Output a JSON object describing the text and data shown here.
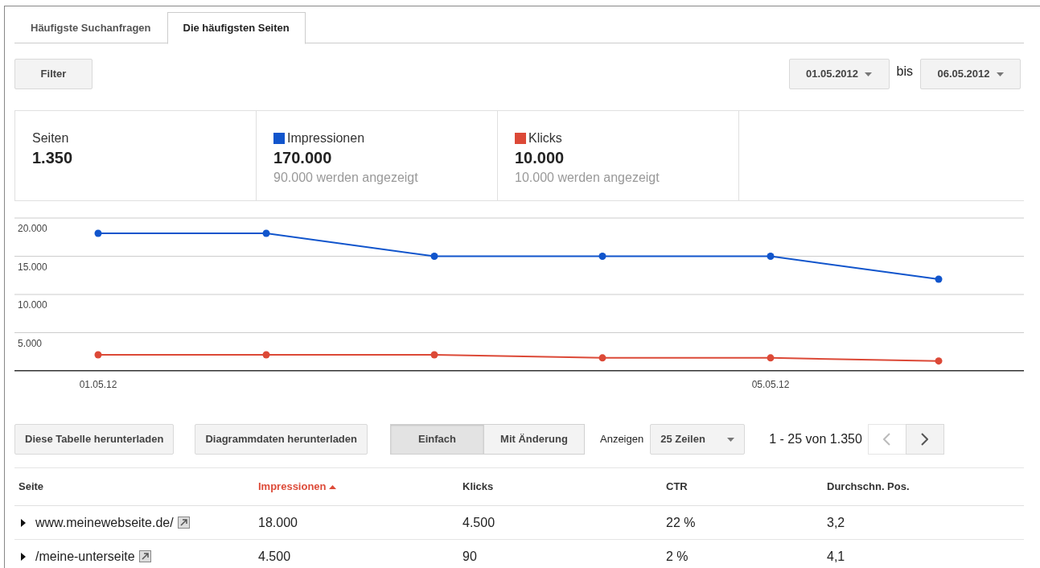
{
  "tabs": [
    {
      "label": "Häufigste Suchanfragen",
      "selected": false
    },
    {
      "label": "Die häufigsten Seiten",
      "selected": true
    }
  ],
  "filter_button": "Filter",
  "date_range": {
    "from": "01.05.2012",
    "separator": "bis",
    "to": "06.05.2012"
  },
  "summary": [
    {
      "label": "Seiten",
      "value": "1.350"
    },
    {
      "label": "Impressionen",
      "value": "170.000",
      "note": "90.000 werden angezeigt",
      "color": "#1155cc"
    },
    {
      "label": "Klicks",
      "value": "10.000",
      "note": "10.000 werden angezeigt",
      "color": "#dc4937"
    }
  ],
  "chart_data": {
    "type": "line",
    "grid": true,
    "categories": [
      "01.05.12",
      null,
      null,
      null,
      "05.05.12",
      null
    ],
    "ylim": [
      0,
      20000
    ],
    "yticks": [
      {
        "value": 5000,
        "label": "5.000"
      },
      {
        "value": 10000,
        "label": "10.000"
      },
      {
        "value": 15000,
        "label": "15.000"
      },
      {
        "value": 20000,
        "label": "20.000"
      }
    ],
    "series": [
      {
        "color": "#1155cc",
        "marker": "circle",
        "values": [
          18000,
          18000,
          15000,
          15000,
          15000,
          12000
        ]
      },
      {
        "color": "#dc4937",
        "marker": "circle",
        "values": [
          2100,
          2100,
          2100,
          1700,
          1700,
          1300
        ]
      }
    ]
  },
  "toolbar": {
    "download_table": "Diese Tabelle herunterladen",
    "download_chart": "Diagrammdaten herunterladen",
    "view_modes": [
      {
        "label": "Einfach",
        "selected": true
      },
      {
        "label": "Mit Änderung",
        "selected": false
      }
    ],
    "show_label": "Anzeigen",
    "rows_select": "25 Zeilen",
    "range": "1 - 25 von 1.350"
  },
  "table": {
    "columns": [
      {
        "label": "Seite",
        "sorted": false
      },
      {
        "label": "Impressionen",
        "sorted": true
      },
      {
        "label": "Klicks",
        "sorted": false
      },
      {
        "label": "CTR",
        "sorted": false
      },
      {
        "label": "Durchschn. Pos.",
        "sorted": false
      }
    ],
    "rows": [
      {
        "expanded": false,
        "cells": [
          "www.meinewebseite.de/",
          "18.000",
          "4.500",
          "22 %",
          "3,2"
        ]
      },
      {
        "expanded": false,
        "cells": [
          "/meine-unterseite",
          "4.500",
          "90",
          "2 %",
          "4,1"
        ]
      }
    ]
  }
}
